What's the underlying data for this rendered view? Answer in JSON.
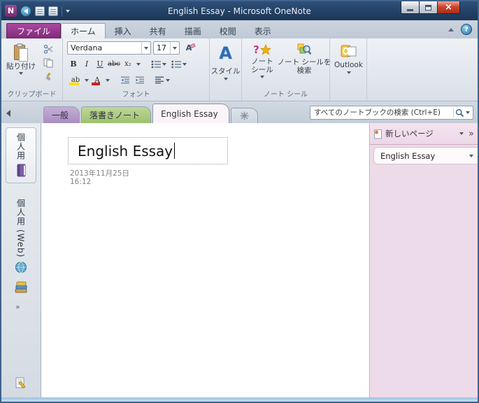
{
  "window": {
    "title": "English Essay -  Microsoft OneNote"
  },
  "ribbon": {
    "file_tab": "ファイル",
    "tabs": [
      {
        "label": "ホーム"
      },
      {
        "label": "挿入"
      },
      {
        "label": "共有"
      },
      {
        "label": "描画"
      },
      {
        "label": "校閲"
      },
      {
        "label": "表示"
      }
    ],
    "clipboard": {
      "group_label": "クリップボード",
      "paste_label": "貼り付け"
    },
    "font": {
      "group_label": "フォント",
      "font_name": "Verdana",
      "font_size": "17",
      "bold": "B",
      "italic": "I",
      "underline": "U",
      "strike": "abc",
      "subscript": "x₂",
      "highlight": "ab",
      "font_color": "A"
    },
    "styles": {
      "label": "スタイル",
      "icon_letter": "A"
    },
    "tags": {
      "group_label": "ノート シール",
      "tag_line1": "ノート",
      "tag_line2": "シール",
      "find_line1": "ノート シールを",
      "find_line2": "検索"
    },
    "outlook": {
      "label": "Outlook"
    }
  },
  "section_bar": {
    "tabs": [
      {
        "label": "一般"
      },
      {
        "label": "落書きノート"
      },
      {
        "label": "English Essay"
      }
    ],
    "search_placeholder": "すべてのノートブックの検索 (Ctrl+E)"
  },
  "nav": {
    "item1_label": "個人用",
    "item2_label": "個人用 (Web)"
  },
  "page": {
    "title": "English Essay",
    "date": "2013年11月25日",
    "time": "16:12"
  },
  "pages_panel": {
    "new_page_label": "新しいページ",
    "pages": [
      {
        "title": "English Essay"
      }
    ]
  },
  "colors": {
    "titlebar": "#24426b",
    "file_tab_purple": "#8e3586",
    "section_general": "#b69bc9",
    "section_doodle": "#a9c87d",
    "panel_pink": "#eedbe9",
    "close_red": "#bb3a26"
  }
}
